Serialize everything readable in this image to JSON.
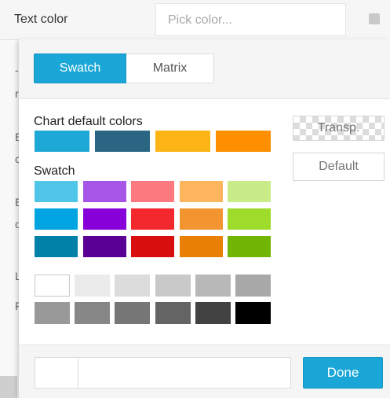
{
  "property": {
    "label": "Text color",
    "placeholder": "Pick color..."
  },
  "background_panel": {
    "glyphs": [
      "-",
      "r",
      "E",
      "c",
      "E",
      "c",
      "L",
      "F"
    ]
  },
  "tabs": [
    {
      "label": "Swatch",
      "active": true
    },
    {
      "label": "Matrix",
      "active": false
    }
  ],
  "chart_defaults": {
    "title": "Chart default colors",
    "colors": [
      "#1ea8d6",
      "#2a6683",
      "#fdb515",
      "#fd8f00"
    ]
  },
  "swatch": {
    "title": "Swatch",
    "rows": [
      [
        "#4fc5e8",
        "#a556e6",
        "#fb7a80",
        "#fdb65e",
        "#c9ec88"
      ],
      [
        "#00a4e0",
        "#8700d9",
        "#f2282d",
        "#f29531",
        "#9edb2a"
      ],
      [
        "#0180a8",
        "#5b0094",
        "#d90e0e",
        "#e97f05",
        "#73b504"
      ]
    ]
  },
  "grays": {
    "rows": [
      [
        "#ffffff",
        "#ebebeb",
        "#dcdcdc",
        "#c9c9c9",
        "#b8b8b8",
        "#a8a8a8"
      ],
      [
        "#999999",
        "#878787",
        "#777777",
        "#646464",
        "#424242",
        "#000000"
      ]
    ]
  },
  "buttons": {
    "transparent": "Transp.",
    "default": "Default",
    "done": "Done"
  },
  "hex_input": {
    "value": ""
  },
  "colors": {
    "accent": "#1aa6d6"
  }
}
